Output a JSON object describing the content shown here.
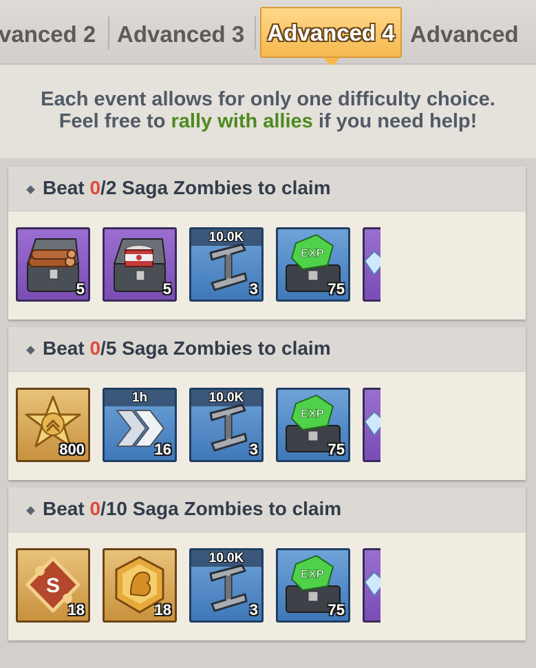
{
  "tabs": [
    {
      "label": "vanced 2"
    },
    {
      "label": "Advanced 3"
    },
    {
      "label": "Advanced 4",
      "active": true
    },
    {
      "label": "Advanced"
    }
  ],
  "info": {
    "line1": "Each event allows for only one difficulty choice.",
    "line2_pre": "Feel free to ",
    "line2_highlight": "rally with allies",
    "line2_post": " if you need help!"
  },
  "colors": {
    "highlight": "#4d8a1e",
    "progress_current": "#e04a3a",
    "active_tab": "#f5b94f"
  },
  "tasks": [
    {
      "prefix": "Beat ",
      "current": "0",
      "target": "/2",
      "suffix": " Saga Zombies to claim",
      "rewards": [
        {
          "icon": "wood-chest-icon",
          "frame": "purple",
          "qty": "5"
        },
        {
          "icon": "food-can-chest-icon",
          "frame": "purple",
          "qty": "5"
        },
        {
          "icon": "steel-beam-icon",
          "frame": "blue",
          "label": "10.0K",
          "qty": "3"
        },
        {
          "icon": "exp-chest-icon",
          "frame": "blue",
          "qty": "75"
        },
        {
          "icon": "diamond-icon",
          "frame": "purple",
          "qty": ""
        }
      ]
    },
    {
      "prefix": "Beat ",
      "current": "0",
      "target": "/5",
      "suffix": " Saga Zombies to claim",
      "rewards": [
        {
          "icon": "sheriff-badge-icon",
          "frame": "gold",
          "qty": "800"
        },
        {
          "icon": "speedup-icon",
          "frame": "blue",
          "label": "1h",
          "qty": "16"
        },
        {
          "icon": "steel-beam-icon",
          "frame": "blue",
          "label": "10.0K",
          "qty": "3"
        },
        {
          "icon": "exp-chest-icon",
          "frame": "blue",
          "qty": "75"
        },
        {
          "icon": "diamond-icon",
          "frame": "purple",
          "qty": ""
        }
      ]
    },
    {
      "prefix": "Beat ",
      "current": "0",
      "target": "/10",
      "suffix": " Saga Zombies to claim",
      "rewards": [
        {
          "icon": "skill-puzzle-icon",
          "frame": "gold",
          "qty": "18"
        },
        {
          "icon": "hero-medal-icon",
          "frame": "gold",
          "qty": "18"
        },
        {
          "icon": "steel-beam-icon",
          "frame": "blue",
          "label": "10.0K",
          "qty": "3"
        },
        {
          "icon": "exp-chest-icon",
          "frame": "blue",
          "qty": "75"
        },
        {
          "icon": "diamond-icon",
          "frame": "purple",
          "qty": ""
        }
      ]
    }
  ]
}
